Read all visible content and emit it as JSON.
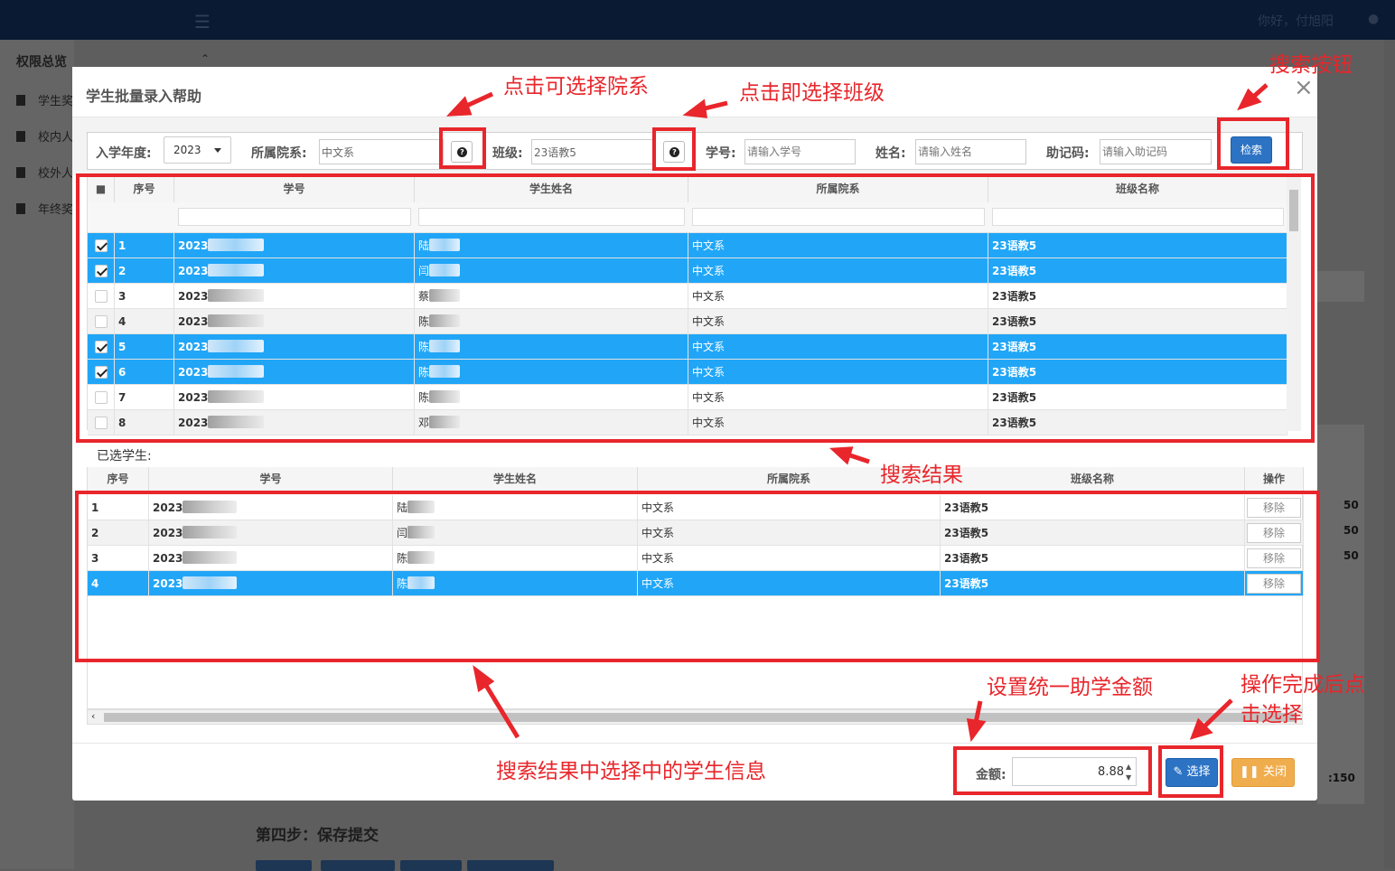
{
  "app": {
    "greeting": "你好，付旭阳",
    "sidebar_title": "权限总览",
    "sidebar_items": [
      "学生奖",
      "校内人",
      "校外人",
      "年终奖"
    ],
    "step_title": "第四步：保存提交",
    "bg_values": [
      "50",
      "50",
      "50",
      ":150"
    ]
  },
  "modal": {
    "title": "学生批量录入帮助",
    "close_glyph": "×",
    "filters": {
      "year_label": "入学年度:",
      "year_value": "2023",
      "dept_label": "所属院系:",
      "dept_value": "中文系",
      "class_label": "班级:",
      "class_value": "23语教5",
      "id_label": "学号:",
      "id_placeholder": "请输入学号",
      "name_label": "姓名:",
      "name_placeholder": "请输入姓名",
      "code_label": "助记码:",
      "code_placeholder": "请输入助记码",
      "search_label": "检索"
    },
    "results": {
      "headers": [
        "序号",
        "学号",
        "学生姓名",
        "所属院系",
        "班级名称"
      ],
      "rows": [
        {
          "no": "1",
          "id": "2023",
          "name": "陆",
          "dept": "中文系",
          "class": "23语教5",
          "checked": true
        },
        {
          "no": "2",
          "id": "2023",
          "name": "闫",
          "dept": "中文系",
          "class": "23语教5",
          "checked": true
        },
        {
          "no": "3",
          "id": "2023",
          "name": "蔡",
          "dept": "中文系",
          "class": "23语教5",
          "checked": false
        },
        {
          "no": "4",
          "id": "2023",
          "name": "陈",
          "dept": "中文系",
          "class": "23语教5",
          "checked": false
        },
        {
          "no": "5",
          "id": "2023",
          "name": "陈",
          "dept": "中文系",
          "class": "23语教5",
          "checked": true
        },
        {
          "no": "6",
          "id": "2023",
          "name": "陈",
          "dept": "中文系",
          "class": "23语教5",
          "checked": true
        },
        {
          "no": "7",
          "id": "2023",
          "name": "陈",
          "dept": "中文系",
          "class": "23语教5",
          "checked": false
        },
        {
          "no": "8",
          "id": "2023",
          "name": "邓",
          "dept": "中文系",
          "class": "23语教5",
          "checked": false
        }
      ]
    },
    "selected": {
      "label": "已选学生:",
      "headers": [
        "序号",
        "学号",
        "学生姓名",
        "所属院系",
        "班级名称",
        "操作"
      ],
      "remove_label": "移除",
      "rows": [
        {
          "no": "1",
          "id": "2023",
          "name": "陆",
          "dept": "中文系",
          "class": "23语教5",
          "highlight": false
        },
        {
          "no": "2",
          "id": "2023",
          "name": "闫",
          "dept": "中文系",
          "class": "23语教5",
          "highlight": false
        },
        {
          "no": "3",
          "id": "2023",
          "name": "陈",
          "dept": "中文系",
          "class": "23语教5",
          "highlight": false
        },
        {
          "no": "4",
          "id": "2023",
          "name": "陈",
          "dept": "中文系",
          "class": "23语教5",
          "highlight": true
        }
      ]
    },
    "footer": {
      "amount_label": "金额:",
      "amount_value": "8.88",
      "choose_label": "选择",
      "close_label": "关闭"
    }
  },
  "annotations": {
    "dept": "点击可选择院系",
    "class": "点击即选择班级",
    "search": "搜索按钮",
    "results": "搜索结果",
    "selected": "搜索结果中选择中的学生信息",
    "amount": "设置统一助学金额",
    "done_line1": "操作完成后点",
    "done_line2": "击选择",
    "color": "#e8262b"
  },
  "colors": {
    "selected_row": "#21a6f7",
    "primary_button": "#2c73c4",
    "warning_button": "#f0ad4e"
  }
}
